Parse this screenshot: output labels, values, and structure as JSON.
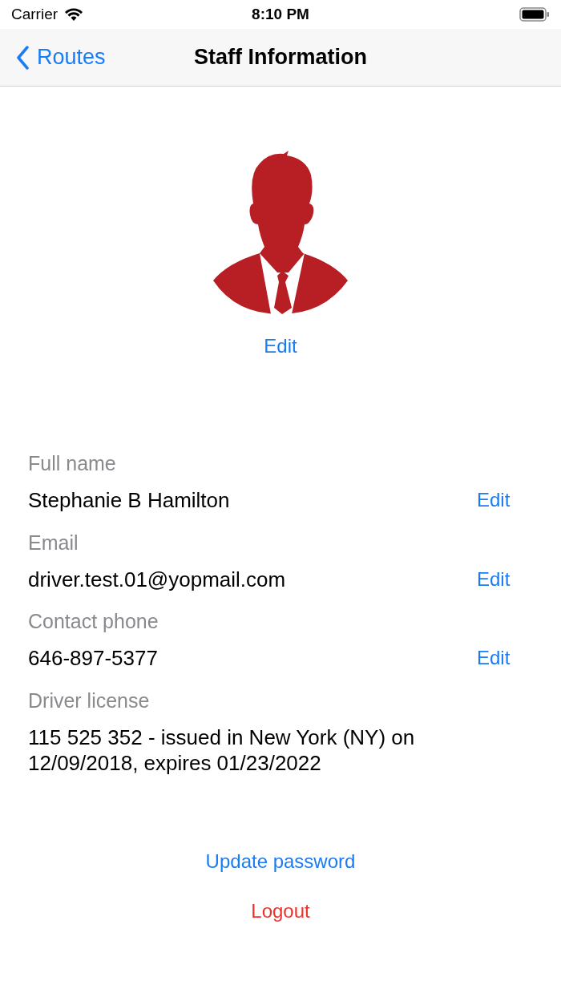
{
  "status_bar": {
    "carrier": "Carrier",
    "time": "8:10 PM"
  },
  "nav": {
    "back": "Routes",
    "title": "Staff Information"
  },
  "avatar": {
    "edit": "Edit"
  },
  "fields": [
    {
      "label": "Full name",
      "value": "Stephanie B Hamilton",
      "edit": "Edit"
    },
    {
      "label": "Email",
      "value": "driver.test.01@yopmail.com",
      "edit": "Edit"
    },
    {
      "label": "Contact phone",
      "value": "646-897-5377",
      "edit": "Edit"
    },
    {
      "label": "Driver license",
      "value": "115 525 352 - issued in New York (NY) on 12/09/2018, expires 01/23/2022"
    }
  ],
  "actions": [
    {
      "label": "Update password",
      "kind": "normal"
    },
    {
      "label": "Logout",
      "kind": "destructive"
    }
  ]
}
